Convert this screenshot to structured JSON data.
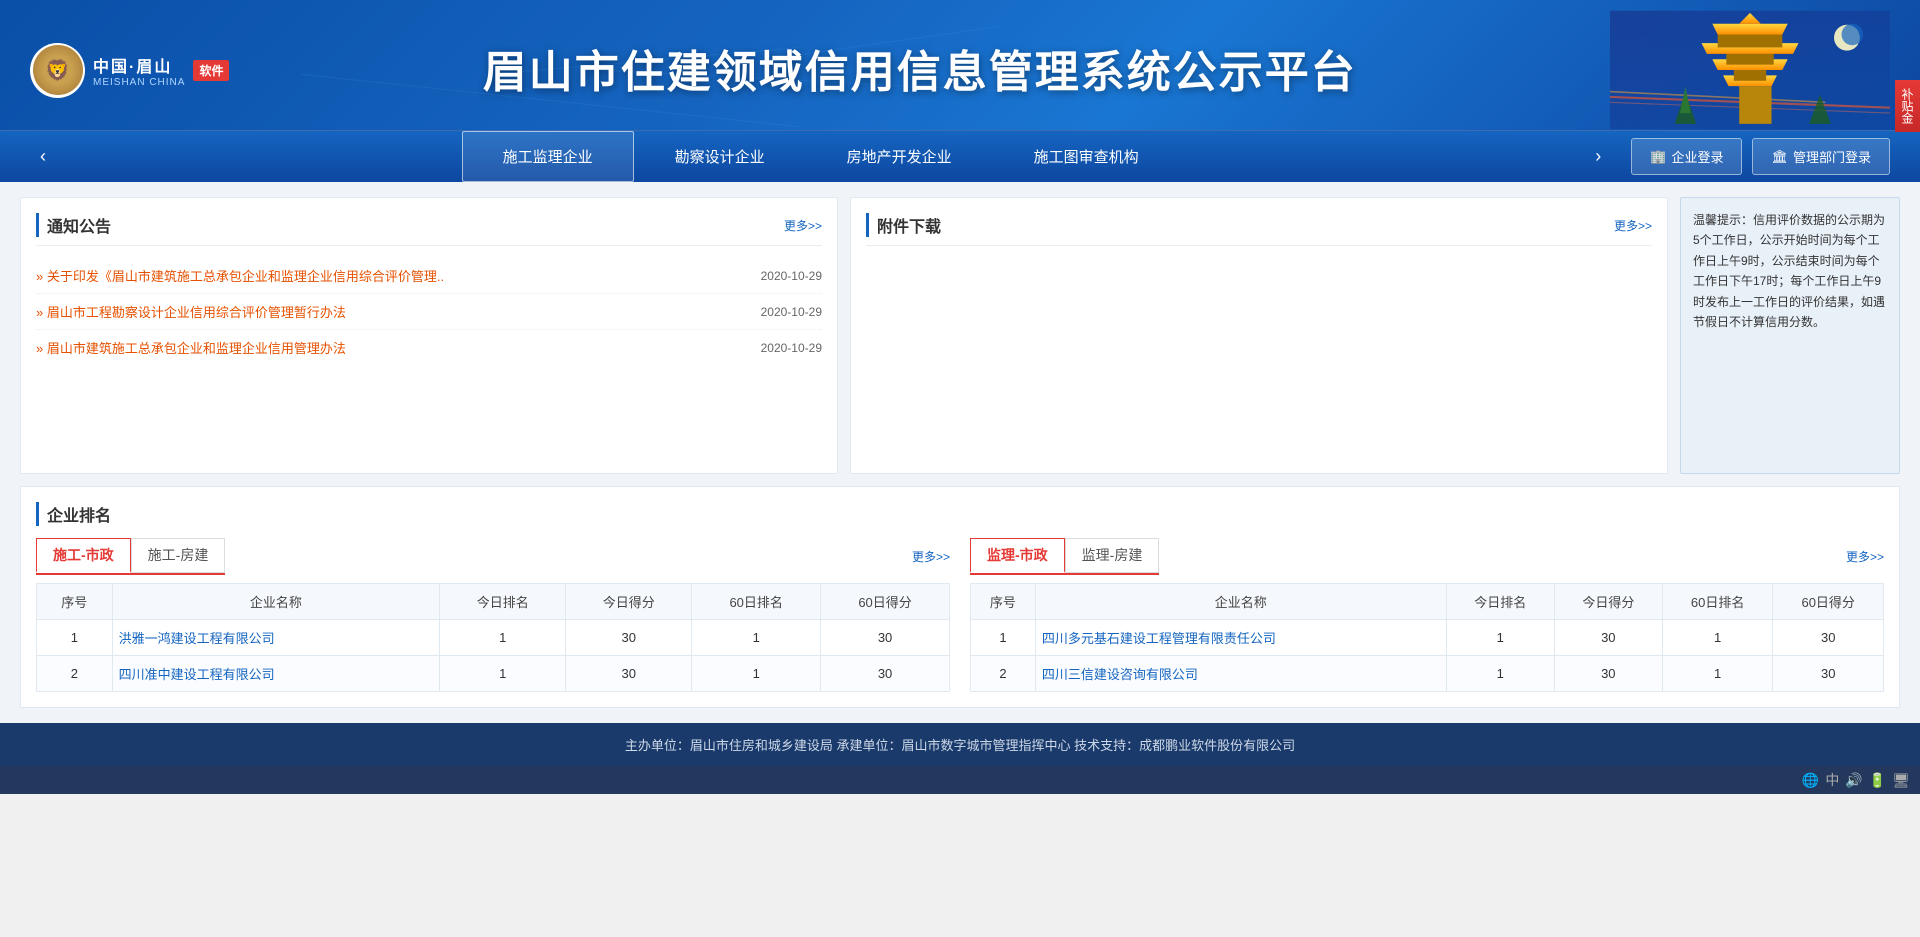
{
  "header": {
    "logo_cn": "中国·眉山",
    "logo_en": "MEISHAN CHINA",
    "logo_badge": "软件",
    "china_text": "CHINA",
    "main_title": "眉山市住建领域信用信息管理系统公示平台",
    "side_badge": "补贴金"
  },
  "nav": {
    "prev_arrow": "‹",
    "next_arrow": "›",
    "items": [
      {
        "label": "施工监理企业",
        "active": true
      },
      {
        "label": "勘察设计企业",
        "active": false
      },
      {
        "label": "房地产开发企业",
        "active": false
      },
      {
        "label": "施工图审查机构",
        "active": false
      }
    ],
    "btn_enterprise": "企业登录",
    "btn_management": "管理部门登录"
  },
  "notices": {
    "title": "通知公告",
    "more": "更多>>",
    "items": [
      {
        "text": "关于印发《眉山市建筑施工总承包企业和监理企业信用综合评价管理..",
        "date": "2020-10-29"
      },
      {
        "text": "眉山市工程勘察设计企业信用综合评价管理暂行办法",
        "date": "2020-10-29"
      },
      {
        "text": "眉山市建筑施工总承包企业和监理企业信用管理办法",
        "date": "2020-10-29"
      }
    ]
  },
  "attachments": {
    "title": "附件下载",
    "more": "更多>>"
  },
  "tip": {
    "text": "温馨提示：信用评价数据的公示期为5个工作日，公示开始时间为每个工作日上午9时，公示结束时间为每个工作日下午17时；每个工作日上午9时发布上一工作日的评价结果，如遇节假日不计算信用分数。"
  },
  "enterprise_ranking": {
    "title": "企业排名",
    "left_panel": {
      "more": "更多>>",
      "tabs": [
        {
          "label": "施工-市政",
          "active": true
        },
        {
          "label": "施工-房建",
          "active": false
        }
      ],
      "columns": [
        "序号",
        "企业名称",
        "今日排名",
        "今日得分",
        "60日排名",
        "60日得分"
      ],
      "rows": [
        {
          "id": 1,
          "name": "洪雅一鸿建设工程有限公司",
          "today_rank": 1,
          "today_score": 30,
          "d60_rank": 1,
          "d60_score": 30
        },
        {
          "id": 2,
          "name": "四川准中建设工程有限公司",
          "today_rank": 1,
          "today_score": 30,
          "d60_rank": 1,
          "d60_score": 30
        }
      ]
    },
    "right_panel": {
      "more": "更多>>",
      "tabs": [
        {
          "label": "监理-市政",
          "active": true
        },
        {
          "label": "监理-房建",
          "active": false
        }
      ],
      "columns": [
        "序号",
        "企业名称",
        "今日排名",
        "今日得分",
        "60日排名",
        "60日得分"
      ],
      "rows": [
        {
          "id": 1,
          "name": "四川多元基石建设工程管理有限责任公司",
          "today_rank": 1,
          "today_score": 30,
          "d60_rank": 1,
          "d60_score": 30
        },
        {
          "id": 2,
          "name": "四川三信建设咨询有限公司",
          "today_rank": 1,
          "today_score": 30,
          "d60_rank": 1,
          "d60_score": 30
        }
      ]
    }
  },
  "footer": {
    "text": "主办单位：眉山市住房和城乡建设局  承建单位：眉山市数字城市管理指挥中心  技术支持：成都鹏业软件股份有限公司"
  }
}
